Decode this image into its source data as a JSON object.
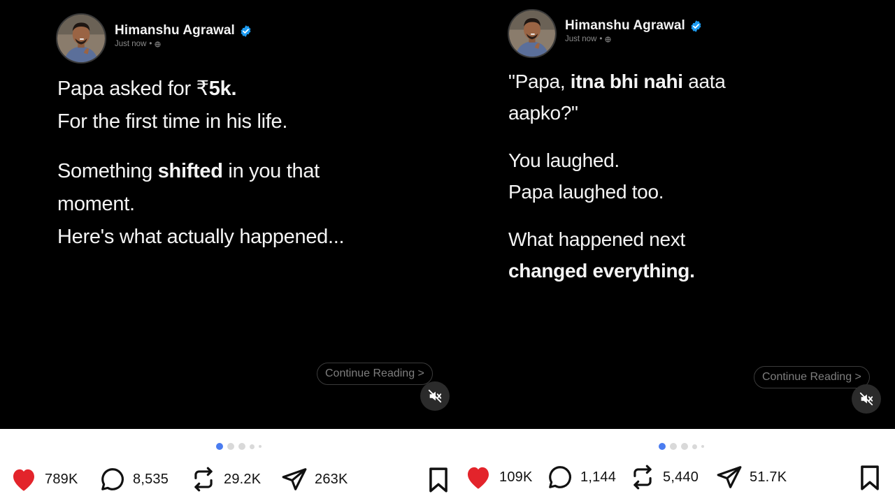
{
  "posts": [
    {
      "author": {
        "name": "Himanshu Agrawal",
        "time": "Just now",
        "separator": "•"
      },
      "text": {
        "line1_pre": "Papa asked for ₹",
        "line1_bold": "5k.",
        "line2": "For the first time in his life.",
        "line3_pre": "Something ",
        "line3_bold": "shifted",
        "line3_post": " in you that",
        "line4": "moment.",
        "line5": "Here's what actually happened..."
      },
      "continue_label": "Continue Reading >",
      "carousel": {
        "current": 1,
        "total": 5
      },
      "stats": {
        "likes": "789K",
        "comments": "8,535",
        "reposts": "29.2K",
        "shares": "263K"
      }
    },
    {
      "author": {
        "name": "Himanshu Agrawal",
        "time": "Just now",
        "separator": "•"
      },
      "text": {
        "line1_pre": "\"Papa, ",
        "line1_bold": "itna bhi nahi",
        "line1_post": " aata",
        "line2": "aapko?\"",
        "line3": "You laughed.",
        "line4": "Papa laughed too.",
        "line5": "What happened next",
        "line6_bold": "changed everything."
      },
      "continue_label": "Continue Reading >",
      "carousel": {
        "current": 1,
        "total": 5
      },
      "stats": {
        "likes": "109K",
        "comments": "1,144",
        "reposts": "5,440",
        "shares": "51.7K"
      }
    }
  ],
  "colors": {
    "like": "#e3242b",
    "verified": "#1d9bf0",
    "dot_active": "#4a7cf0",
    "media_bg": "#000000"
  },
  "icons": [
    "verified-badge-icon",
    "globe-icon",
    "mute-icon",
    "heart-icon",
    "comment-icon",
    "repost-icon",
    "share-icon",
    "bookmark-icon"
  ]
}
